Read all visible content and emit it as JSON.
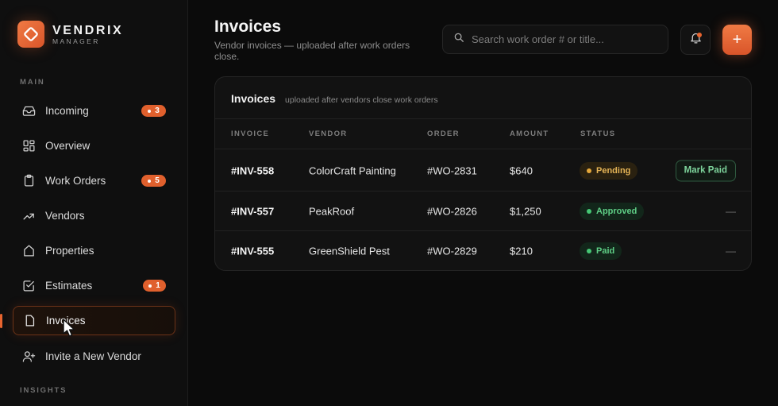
{
  "brand": {
    "name": "VENDRIX",
    "sub": "MANAGER"
  },
  "sidebar": {
    "main_label": "MAIN",
    "insights_label": "INSIGHTS",
    "items": [
      {
        "label": "Incoming",
        "icon": "inbox-icon",
        "badge": "3"
      },
      {
        "label": "Overview",
        "icon": "grid-icon",
        "badge": null
      },
      {
        "label": "Work Orders",
        "icon": "clipboard-icon",
        "badge": "5"
      },
      {
        "label": "Vendors",
        "icon": "trend-arrow-icon",
        "badge": null
      },
      {
        "label": "Properties",
        "icon": "home-icon",
        "badge": null
      },
      {
        "label": "Estimates",
        "icon": "checkbox-icon",
        "badge": "1"
      },
      {
        "label": "Invoices",
        "icon": "document-icon",
        "badge": null,
        "active": true
      },
      {
        "label": "Invite a New Vendor",
        "icon": "user-plus-icon",
        "badge": null
      }
    ]
  },
  "header": {
    "title": "Invoices",
    "subtitle": "Vendor invoices — uploaded after work orders close.",
    "search_placeholder": "Search work order # or title...",
    "add_label": "+"
  },
  "card": {
    "title": "Invoices",
    "subtitle": "uploaded after vendors close work orders",
    "columns": [
      "INVOICE",
      "VENDOR",
      "ORDER",
      "AMOUNT",
      "STATUS"
    ],
    "rows": [
      {
        "invoice": "#INV-558",
        "vendor": "ColorCraft Painting",
        "order": "#WO-2831",
        "amount": "$640",
        "status": "Pending",
        "action": "Mark Paid"
      },
      {
        "invoice": "#INV-557",
        "vendor": "PeakRoof",
        "order": "#WO-2826",
        "amount": "$1,250",
        "status": "Approved",
        "action": "—"
      },
      {
        "invoice": "#INV-555",
        "vendor": "GreenShield Pest",
        "order": "#WO-2829",
        "amount": "$210",
        "status": "Paid",
        "action": "—"
      }
    ]
  },
  "colors": {
    "accent": "#e8642f",
    "pending": "#e5a83a",
    "approved": "#45c774",
    "paid": "#45c774"
  }
}
